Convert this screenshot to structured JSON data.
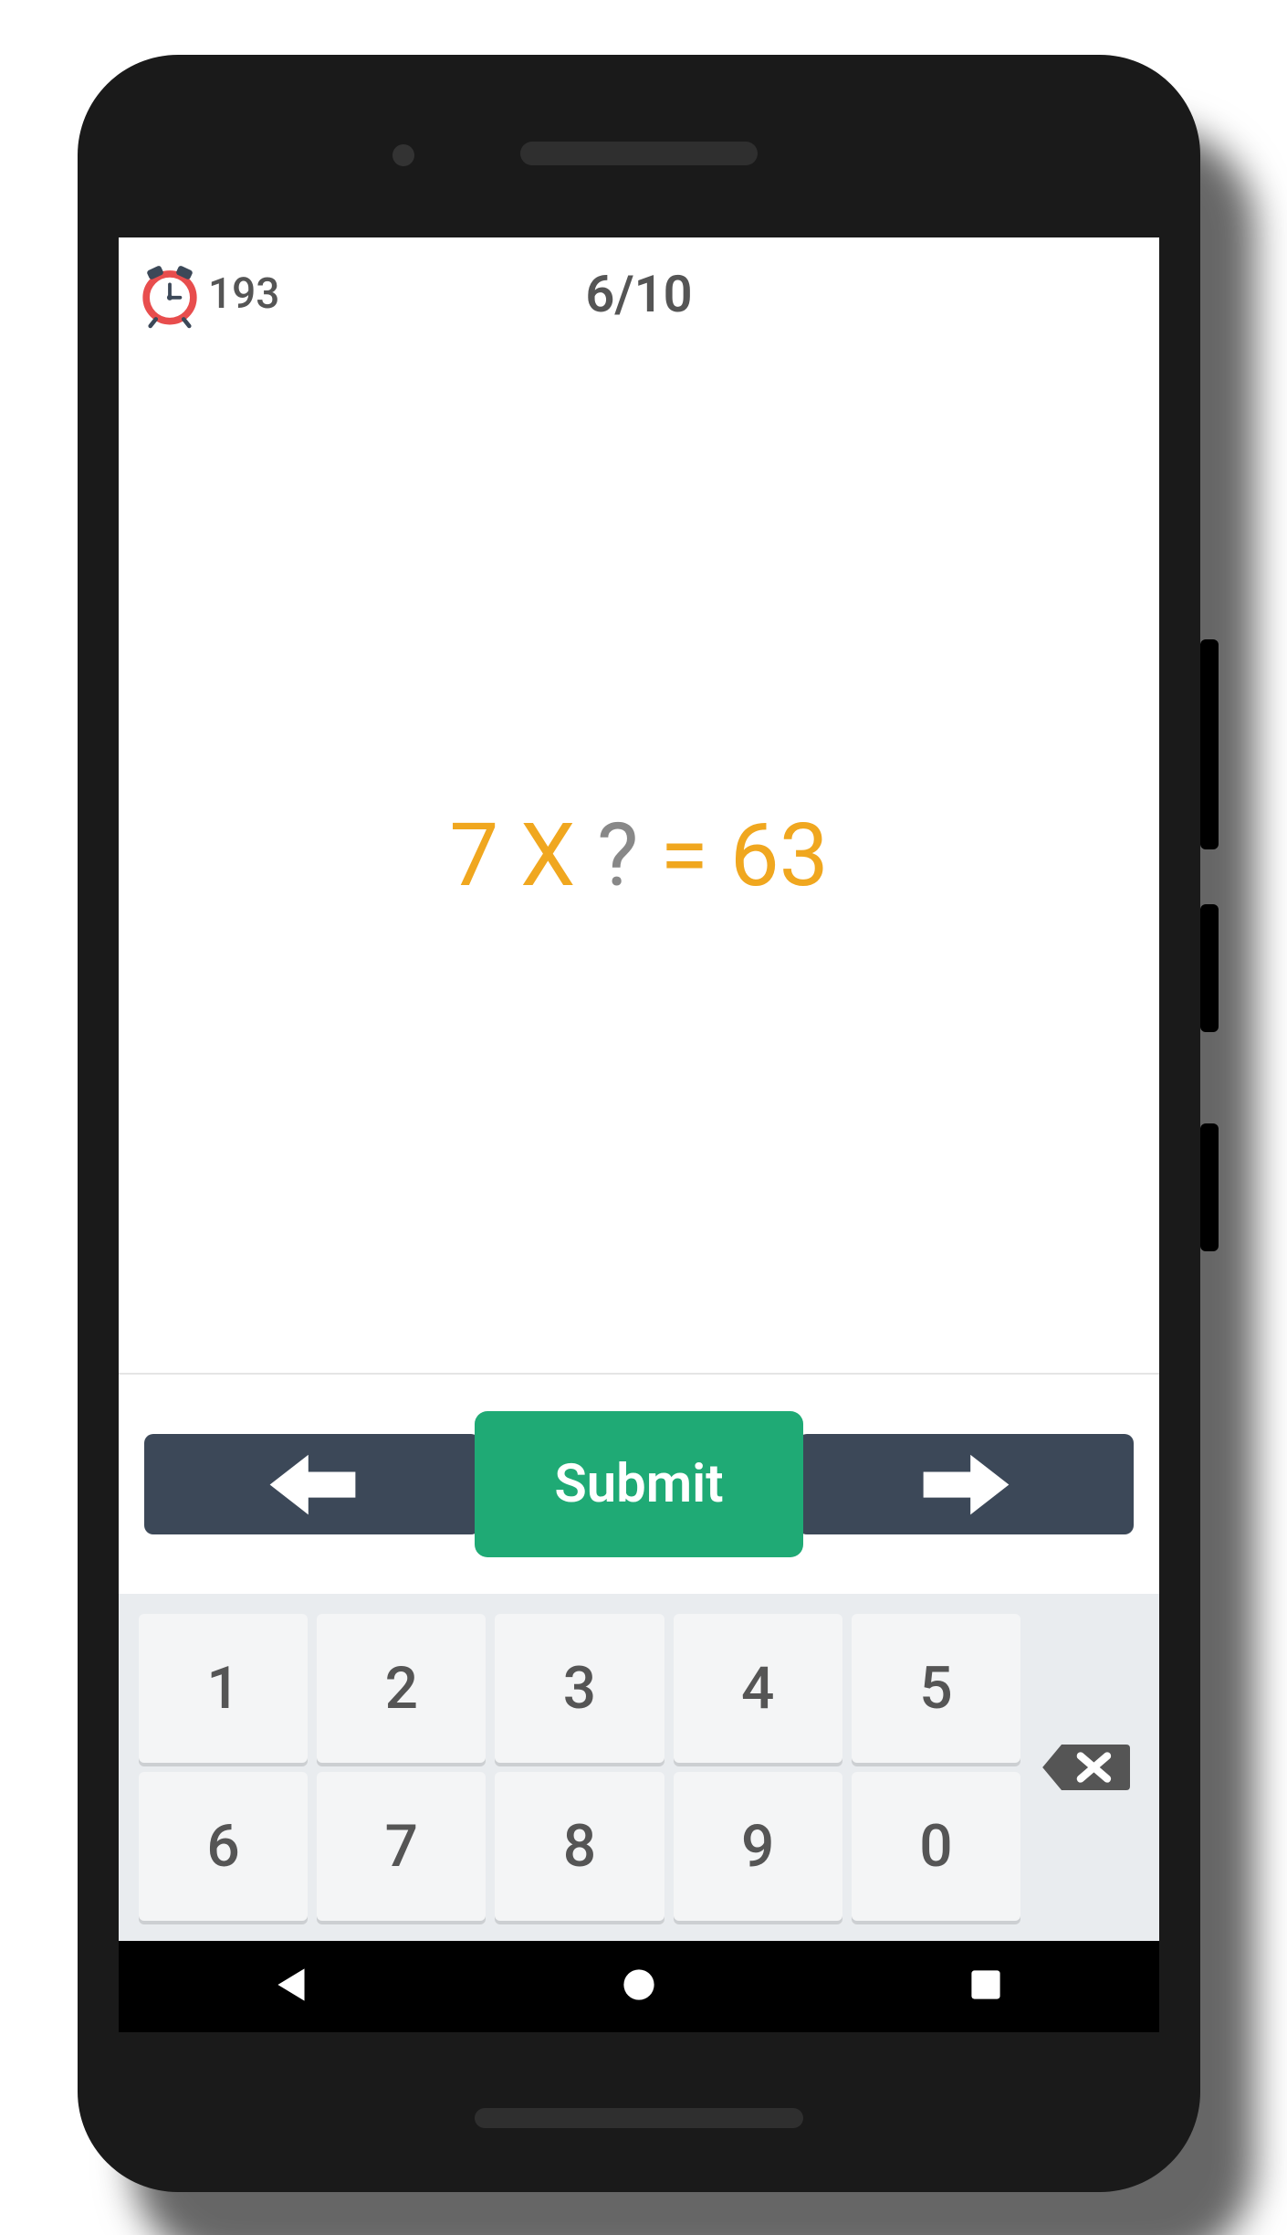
{
  "header": {
    "timer_value": "193",
    "progress": "6/10"
  },
  "equation": {
    "part1": "7 X ",
    "unknown": "?",
    "part2": " = 63"
  },
  "controls": {
    "submit_label": "Submit"
  },
  "keypad": {
    "row1": [
      "1",
      "2",
      "3",
      "4",
      "5"
    ],
    "row2": [
      "6",
      "7",
      "8",
      "9",
      "0"
    ]
  }
}
